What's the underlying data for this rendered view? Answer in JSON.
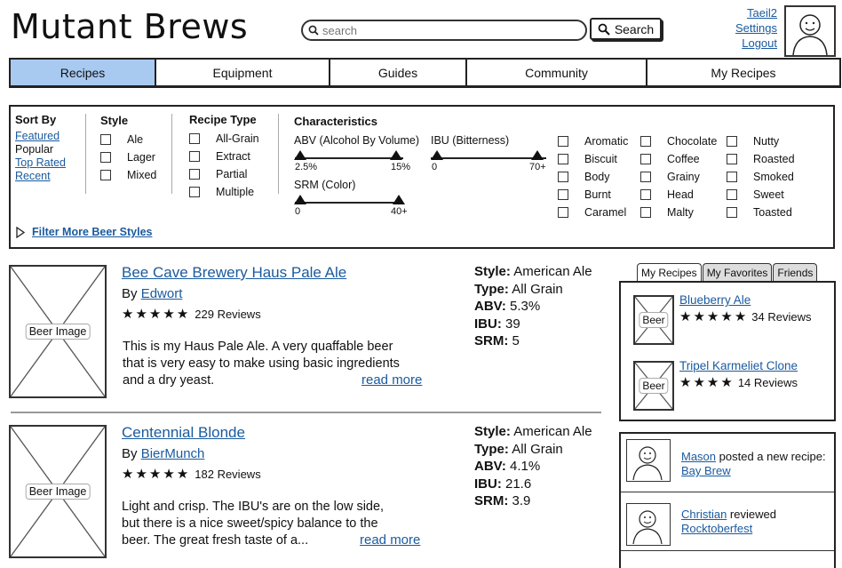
{
  "header": {
    "brand": "Mutant Brews",
    "search_placeholder": "search",
    "search_button": "Search",
    "user_links": [
      "Taeil2",
      "Settings",
      "Logout"
    ]
  },
  "nav": {
    "tabs": [
      {
        "label": "Recipes",
        "active": true
      },
      {
        "label": "Equipment"
      },
      {
        "label": "Guides"
      },
      {
        "label": "Community"
      },
      {
        "label": "My Recipes"
      }
    ]
  },
  "filters": {
    "sort_by": {
      "title": "Sort By",
      "options": [
        {
          "label": "Featured",
          "link": true
        },
        {
          "label": "Popular",
          "link": false
        },
        {
          "label": "Top Rated",
          "link": true
        },
        {
          "label": "Recent",
          "link": true
        }
      ]
    },
    "style": {
      "title": "Style",
      "options": [
        "Ale",
        "Lager",
        "Mixed"
      ]
    },
    "recipe_type": {
      "title": "Recipe Type",
      "options": [
        "All-Grain",
        "Extract",
        "Partial",
        "Multiple"
      ]
    },
    "characteristics": {
      "title": "Characteristics",
      "abv": {
        "label": "ABV (Alcohol By Volume)",
        "min": "2.5%",
        "max": "15%"
      },
      "ibu": {
        "label": "IBU (Bitterness)",
        "min": "0",
        "max": "70+"
      },
      "srm": {
        "label": "SRM (Color)",
        "min": "0",
        "max": "40+"
      },
      "flavors": [
        [
          "Aromatic",
          "Biscuit",
          "Body",
          "Burnt",
          "Caramel"
        ],
        [
          "Chocolate",
          "Coffee",
          "Grainy",
          "Head",
          "Malty"
        ],
        [
          "Nutty",
          "Roasted",
          "Smoked",
          "Sweet",
          "Toasted"
        ]
      ]
    },
    "more": "Filter More Beer Styles"
  },
  "recipes": [
    {
      "image_label": "Beer Image",
      "title": "Bee Cave Brewery Haus Pale Ale",
      "by": "By",
      "author": "Edwort",
      "reviews": "229 Reviews",
      "rating": 5,
      "desc": [
        "This is my Haus Pale Ale. A very quaffable beer",
        "that is very easy to make using basic ingredients",
        "and a dry yeast."
      ],
      "read_more": "read more",
      "stats": [
        {
          "k": "Style:",
          "v": "American Ale"
        },
        {
          "k": "Type:",
          "v": "All Grain"
        },
        {
          "k": "ABV:",
          "v": "5.3%"
        },
        {
          "k": "IBU:",
          "v": "39"
        },
        {
          "k": "SRM:",
          "v": "5"
        }
      ]
    },
    {
      "image_label": "Beer Image",
      "title": "Centennial Blonde",
      "by": "By",
      "author": "BierMunch",
      "reviews": "182 Reviews",
      "rating": 5,
      "desc": [
        "Light and crisp. The IBU's are on the low side,",
        "but there is a nice sweet/spicy balance to the",
        "beer. The great fresh taste of a..."
      ],
      "read_more": "read more",
      "stats": [
        {
          "k": "Style:",
          "v": "American Ale"
        },
        {
          "k": "Type:",
          "v": "All Grain"
        },
        {
          "k": "ABV:",
          "v": "4.1%"
        },
        {
          "k": "IBU:",
          "v": "21.6"
        },
        {
          "k": "SRM:",
          "v": "3.9"
        }
      ]
    }
  ],
  "sidebar": {
    "tabs": [
      {
        "label": "My Recipes",
        "active": true
      },
      {
        "label": "My Favorites"
      },
      {
        "label": "Friends"
      }
    ],
    "items": [
      {
        "image_label": "Beer",
        "title": "Blueberry Ale",
        "reviews": "34 Reviews",
        "rating": 5
      },
      {
        "image_label": "Beer",
        "title": "Tripel Karmeliet Clone",
        "reviews": "14 Reviews",
        "rating": 4
      }
    ],
    "feed": [
      {
        "user": "Mason",
        "action": "posted a new recipe:",
        "target": "Bay Brew"
      },
      {
        "user": "Christian",
        "action": "reviewed",
        "target": "Rocktoberfest"
      }
    ]
  }
}
